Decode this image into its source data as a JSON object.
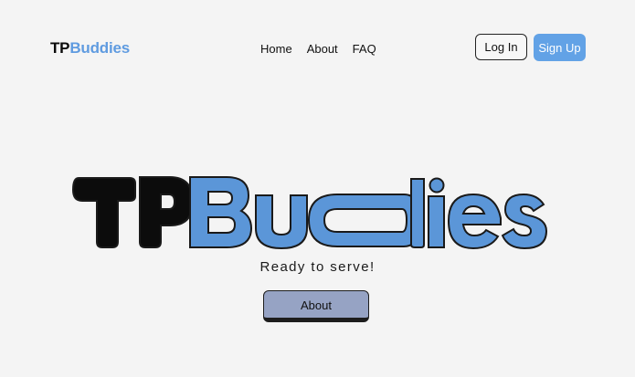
{
  "header": {
    "brand_tp": "TP",
    "brand_buddies": "Buddies",
    "nav": [
      "Home",
      "About",
      "FAQ"
    ],
    "login_label": "Log In",
    "signup_label": "Sign Up"
  },
  "hero": {
    "logo_tp": "TP",
    "logo_buddies": "Buddies",
    "tagline": "Ready to serve!",
    "about_button": "About"
  },
  "colors": {
    "brand_blue": "#62a2e6",
    "logo_blue": "#5b96d8",
    "about_button_bg": "#96a3c4",
    "background": "#f4f4f4"
  }
}
